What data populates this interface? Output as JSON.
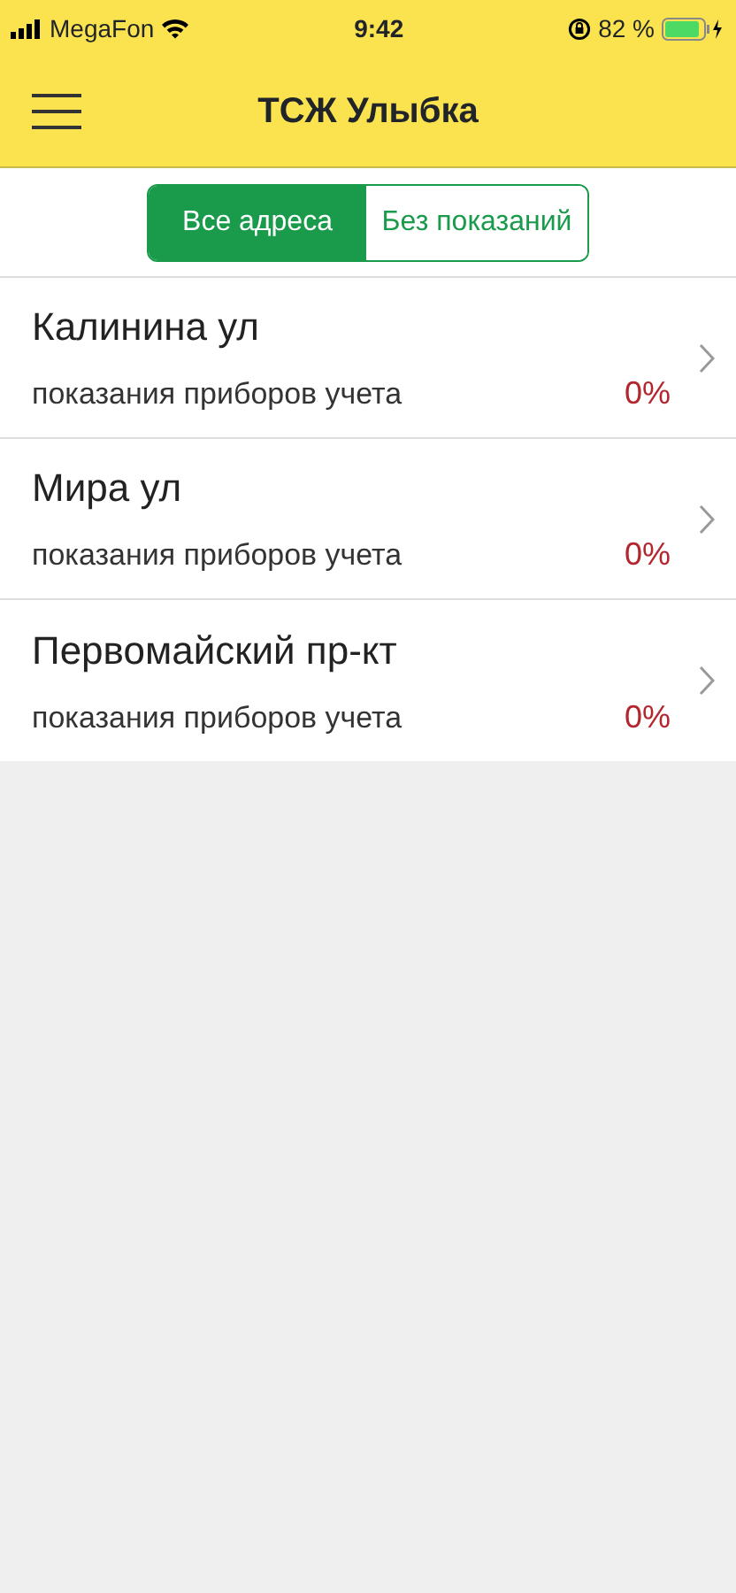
{
  "status_bar": {
    "carrier": "MegaFon",
    "time": "9:42",
    "battery_percent": "82 %"
  },
  "header": {
    "title": "ТСЖ Улыбка"
  },
  "tabs": [
    {
      "label": "Все адреса",
      "selected": true
    },
    {
      "label": "Без показаний",
      "selected": false
    }
  ],
  "addresses": [
    {
      "name": "Калинина ул",
      "subtitle": "показания приборов учета",
      "percent": "0%"
    },
    {
      "name": "Мира ул",
      "subtitle": "показания приборов учета",
      "percent": "0%"
    },
    {
      "name": "Первомайский пр-кт",
      "subtitle": "показания приборов учета",
      "percent": "0%"
    }
  ]
}
